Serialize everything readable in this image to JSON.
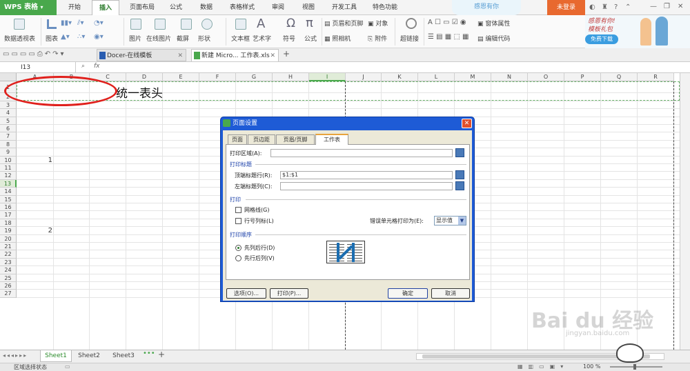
{
  "app": {
    "name": "WPS 表格",
    "login": "未登录",
    "banner_text": "感恩有你",
    "promo_line1": "感恩有你!",
    "promo_line2": "模板礼包",
    "promo_button": "免费下载"
  },
  "menu_tabs": [
    "开始",
    "插入",
    "页面布局",
    "公式",
    "数据",
    "表格样式",
    "审阅",
    "视图",
    "开发工具",
    "特色功能"
  ],
  "active_tab": "插入",
  "toolbar": {
    "pivot": "数据透视表",
    "chart": "图表",
    "picture": "图片",
    "online_picture": "在线图片",
    "screenshot": "截屏",
    "shape": "形状",
    "textbox": "文本框",
    "wordart": "艺术字",
    "symbol": "符号",
    "formula": "公式",
    "header_footer": "页眉和页脚",
    "object": "对象",
    "camera": "照相机",
    "attachment": "附件",
    "hyperlink": "超链接",
    "form_props": "窗体属性",
    "edit_code": "编辑代码",
    "pi_symbol": "π",
    "a_symbol": "A",
    "omega_symbol": "Ω"
  },
  "doc_tabs": [
    "Docer-在线模板",
    "新建 Microsoft Excel 工作表.xls"
  ],
  "doc_tab_display": [
    "Docer-在线模板",
    "新建 Micro... 工作表.xls"
  ],
  "namebox": "I13",
  "fx": "fx",
  "columns": [
    "A",
    "B",
    "C",
    "D",
    "E",
    "F",
    "G",
    "H",
    "I",
    "J",
    "K",
    "L",
    "M",
    "N",
    "O",
    "P",
    "Q",
    "R"
  ],
  "rows": [
    "1",
    "2",
    "3",
    "4",
    "5",
    "6",
    "7",
    "8",
    "9",
    "10",
    "11",
    "12",
    "13",
    "14",
    "15",
    "16",
    "17",
    "18",
    "19",
    "20",
    "21",
    "22",
    "23",
    "24",
    "25",
    "26",
    "27"
  ],
  "cells": {
    "title": "统一表头",
    "a10": "1",
    "a19": "2"
  },
  "sheets": [
    "Sheet1",
    "Sheet2",
    "Sheet3"
  ],
  "active_sheet": "Sheet1",
  "status": {
    "left": "区域选择状态",
    "zoom": "100 %"
  },
  "dialog": {
    "title": "页面设置",
    "tabs": [
      "页面",
      "页边距",
      "页眉/页脚",
      "工作表"
    ],
    "active_tab": "工作表",
    "print_area_label": "打印区域(A):",
    "print_titles_section": "打印标题",
    "top_rows_label": "顶端标题行(R):",
    "top_rows_value": "$1:$1",
    "left_cols_label": "左端标题列(C):",
    "print_section": "打印",
    "gridlines_label": "网格线(G)",
    "row_col_headings_label": "行号列标(L)",
    "cell_errors_label": "错误单元格打印为(E):",
    "cell_errors_value": "显示值",
    "order_section": "打印顺序",
    "down_then_over": "先列后行(D)",
    "over_then_down": "先行后列(V)",
    "options_button": "选项(O)...",
    "print_button": "打印(P)...",
    "ok_button": "确定",
    "cancel_button": "取消"
  },
  "watermark": {
    "brand": "Bai du 经验",
    "url": "jingyan.baidu.com"
  },
  "colors": {
    "wps_green": "#49a84c",
    "active_tab_text": "#2a7a2a",
    "login_orange": "#e8692f",
    "dialog_blue": "#1e5bd6",
    "red_annotation": "#e0201c",
    "dashed_green": "#6bb36b"
  }
}
